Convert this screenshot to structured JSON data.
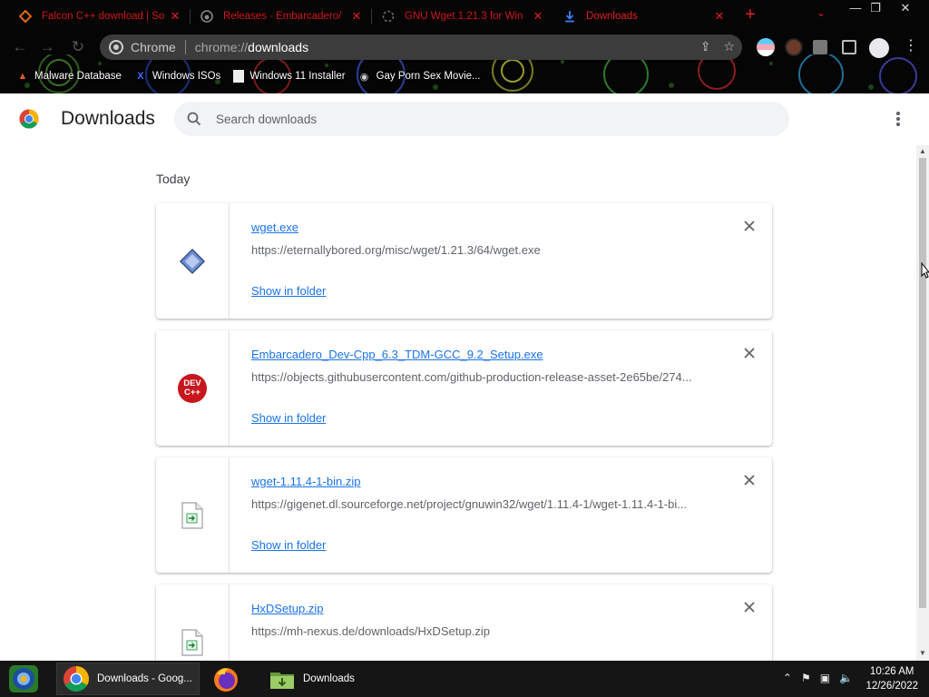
{
  "browser": {
    "tabs": [
      {
        "title": "Falcon C++ download | So",
        "favicon": "falcon-icon"
      },
      {
        "title": "Releases · Embarcadero/",
        "favicon": "github-icon"
      },
      {
        "title": "GNU Wget 1.21.3 for Win",
        "favicon": "spinner-icon"
      },
      {
        "title": "Downloads",
        "favicon": "download-icon"
      }
    ],
    "new_tab_label": "+",
    "omnibox": {
      "origin": "Chrome",
      "scheme": "chrome://",
      "path": "downloads"
    },
    "bookmarks": [
      {
        "label": "Malware Database",
        "icon": "flame-icon"
      },
      {
        "label": "Windows ISOs",
        "icon": "x-logo-icon"
      },
      {
        "label": "Windows 11 Installer",
        "icon": "page-icon"
      },
      {
        "label": "Gay Porn Sex Movie...",
        "icon": "site-icon"
      }
    ]
  },
  "downloads_page": {
    "title": "Downloads",
    "search_placeholder": "Search downloads",
    "group_label": "Today",
    "items": [
      {
        "file_name": "wget.exe",
        "url": "https://eternallybored.org/misc/wget/1.21.3/64/wget.exe",
        "action": "Show in folder",
        "icon": "exe-diamond-icon"
      },
      {
        "file_name": "Embarcadero_Dev-Cpp_6.3_TDM-GCC_9.2_Setup.exe",
        "url": "https://objects.githubusercontent.com/github-production-release-asset-2e65be/274...",
        "action": "Show in folder",
        "icon": "devcpp-icon",
        "icon_text": "DEV C++"
      },
      {
        "file_name": "wget-1.11.4-1-bin.zip",
        "url": "https://gigenet.dl.sourceforge.net/project/gnuwin32/wget/1.11.4-1/wget-1.11.4-1-bi...",
        "action": "Show in folder",
        "icon": "zip-file-icon"
      },
      {
        "file_name": "HxDSetup.zip",
        "url": "https://mh-nexus.de/downloads/HxDSetup.zip",
        "action": "",
        "icon": "zip-file-icon"
      }
    ]
  },
  "taskbar": {
    "items": [
      {
        "label": "Downloads - Goog...",
        "icon": "chrome-icon",
        "active": true
      },
      {
        "label": "",
        "icon": "firefox-icon",
        "active": false
      },
      {
        "label": "Downloads",
        "icon": "folder-icon",
        "active": false
      }
    ],
    "clock": {
      "time": "10:26 AM",
      "date": "12/26/2022"
    }
  },
  "colors": {
    "link": "#1a73e8",
    "tab_text": "#d01818",
    "tab_active_text": "#e02020",
    "taskbar_bg": "#151515"
  }
}
